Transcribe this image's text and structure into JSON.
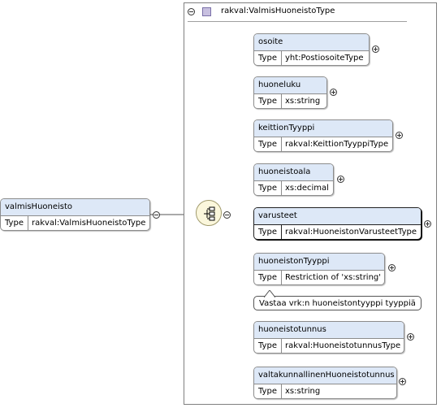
{
  "type_box": {
    "title": "rakval:ValmisHuoneistoType"
  },
  "root": {
    "name": "valmisHuoneisto",
    "type_key": "Type",
    "type_value": "rakval:ValmisHuoneistoType"
  },
  "elements": [
    {
      "name": "osoite",
      "type_key": "Type",
      "type_value": "yht:PostiosoiteType"
    },
    {
      "name": "huoneluku",
      "type_key": "Type",
      "type_value": "xs:string"
    },
    {
      "name": "keittionTyyppi",
      "type_key": "Type",
      "type_value": "rakval:KeittionTyyppiType"
    },
    {
      "name": "huoneistoala",
      "type_key": "Type",
      "type_value": "xs:decimal"
    },
    {
      "name": "varusteet",
      "type_key": "Type",
      "type_value": "rakval:HuoneistonVarusteetType"
    },
    {
      "name": "huoneistonTyyppi",
      "type_key": "Type",
      "type_value": "Restriction of 'xs:string'"
    },
    {
      "name": "huoneistotunnus",
      "type_key": "Type",
      "type_value": "rakval:HuoneistotunnusType"
    },
    {
      "name": "valtakunnallinenHuoneistotunnus",
      "type_key": "Type",
      "type_value": "xs:string"
    }
  ],
  "annotation": {
    "text": "Vastaa vrk:n huoneistontyyppi tyyppiä"
  },
  "colors": {
    "header_fill": "#dde8f7",
    "sequence_fill": "#fbf7dc",
    "type_icon": "#c8c0e0"
  }
}
